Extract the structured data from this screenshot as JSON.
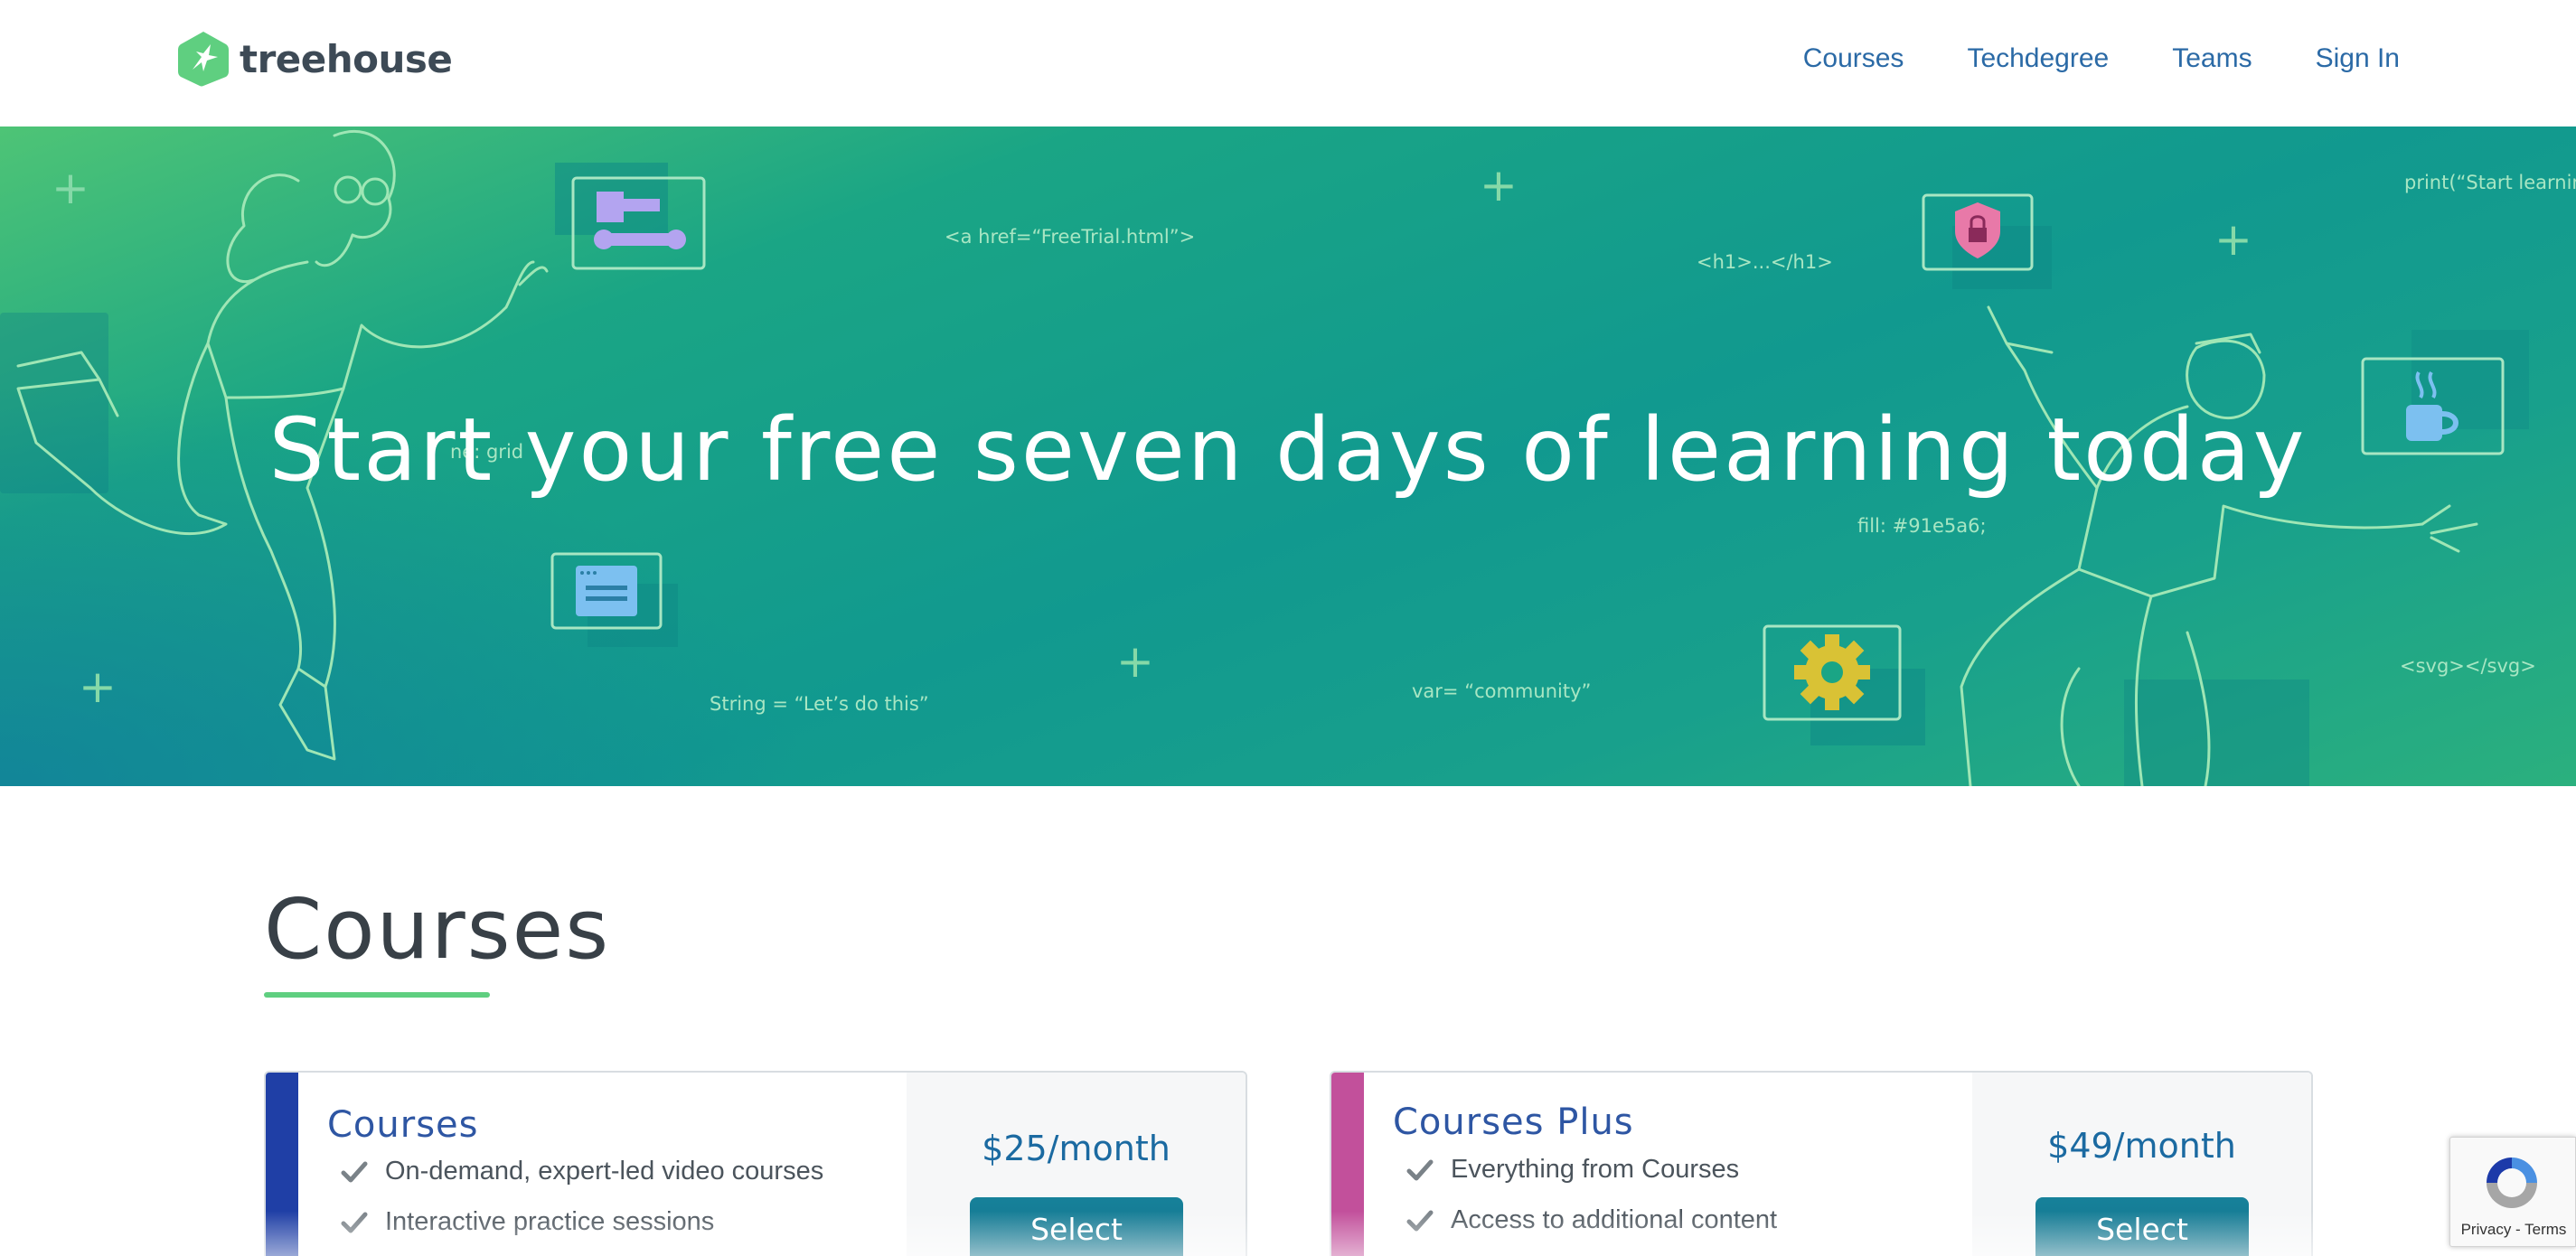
{
  "brand": {
    "name": "treehouse",
    "mark_color": "#5fcf80"
  },
  "nav": {
    "links": [
      {
        "label": "Courses"
      },
      {
        "label": "Techdegree"
      },
      {
        "label": "Teams"
      },
      {
        "label": "Sign In"
      }
    ]
  },
  "hero": {
    "title": "Start your free seven days of learning today",
    "snippets": {
      "href": "<a href=“FreeTrial.html”>",
      "h1": "<h1>...</h1>",
      "print": "print(“Start learnin",
      "grid": "ne: grid",
      "fill": "fill: #91e5a6;",
      "string": "String = “Let’s do this”",
      "var": "var= “community”",
      "svg": "<svg></svg>"
    },
    "icons": [
      "brush-wrench-icon",
      "shield-lock-icon",
      "coffee-cup-icon",
      "browser-window-icon",
      "gear-icon"
    ]
  },
  "courses_section": {
    "title": "Courses",
    "accent": "#5fcf80"
  },
  "plans": [
    {
      "name": "Courses",
      "stripe_color": "#1f3fa6",
      "price": "$25/month",
      "button": "Select",
      "features": [
        "On-demand, expert-led video courses",
        "Interactive practice sessions"
      ]
    },
    {
      "name": "Courses Plus",
      "stripe_color": "#c2509b",
      "price": "$49/month",
      "button": "Select",
      "features": [
        "Everything from Courses",
        "Access to additional content"
      ]
    }
  ],
  "recaptcha": {
    "links": "Privacy - Terms"
  }
}
